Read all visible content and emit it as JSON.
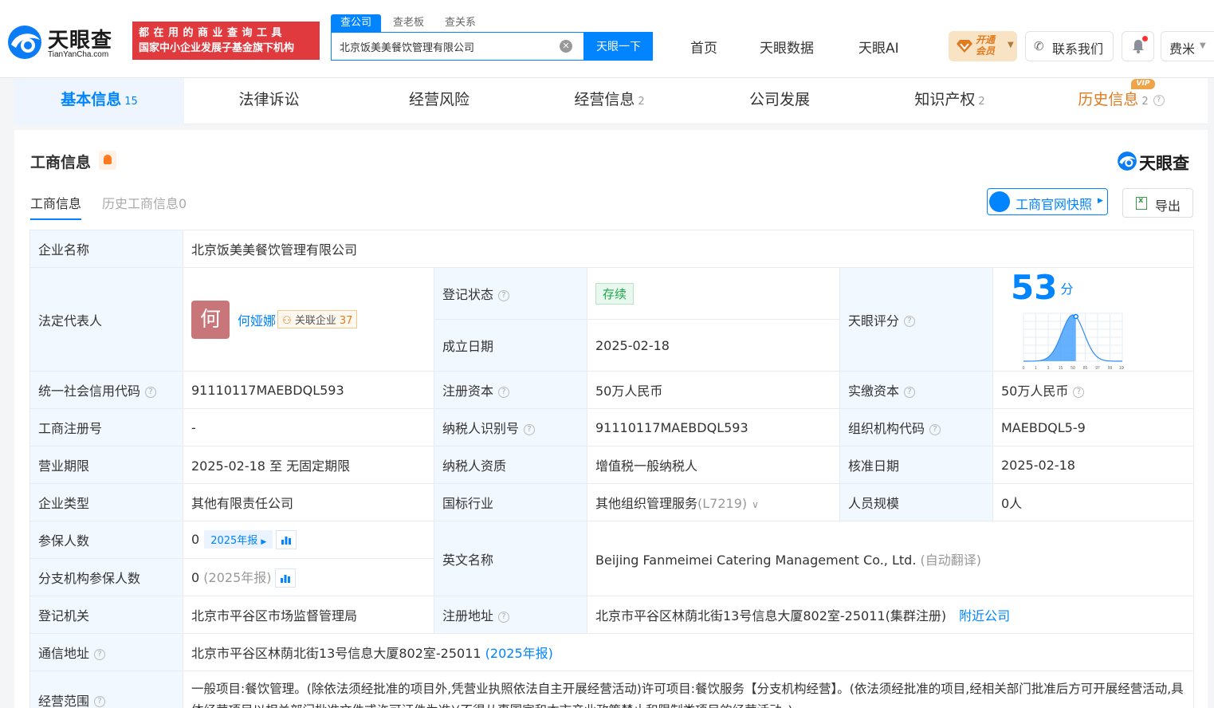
{
  "brand": {
    "logo_text": "天眼查",
    "logo_sub": "TianYanCha.com",
    "slogan_line1": "都在用的商业查询工具",
    "slogan_line2": "国家中小企业发展子基金旗下机构"
  },
  "search": {
    "tabs": [
      "查公司",
      "查老板",
      "查关系"
    ],
    "value": "北京饭美美餐饮管理有限公司",
    "button": "天眼一下"
  },
  "topnav": [
    "首页",
    "天眼数据",
    "天眼AI"
  ],
  "header_actions": {
    "vip_line1": "开通",
    "vip_line2": "会员",
    "contact": "联系我们",
    "user": "费米"
  },
  "main_tabs": [
    {
      "label": "基本信息",
      "count": "15"
    },
    {
      "label": "法律诉讼",
      "count": ""
    },
    {
      "label": "经营风险",
      "count": ""
    },
    {
      "label": "经营信息",
      "count": "2"
    },
    {
      "label": "公司发展",
      "count": ""
    },
    {
      "label": "知识产权",
      "count": "2"
    },
    {
      "label": "历史信息",
      "count": "2",
      "badge": "VIP"
    }
  ],
  "section": {
    "title": "工商信息",
    "brand": "天眼查",
    "subtabs": [
      "工商信息",
      "历史工商信息0"
    ],
    "snapshot_button": "工商官网快照",
    "export_button": "导出"
  },
  "info": {
    "company_name_label": "企业名称",
    "company_name": "北京饭美美餐饮管理有限公司",
    "legal_rep_label": "法定代表人",
    "legal_rep_avatar": "何",
    "legal_rep_name": "何娅娜",
    "related_label": "关联企业",
    "related_count": "37",
    "reg_status_label": "登记状态",
    "reg_status": "存续",
    "found_date_label": "成立日期",
    "found_date": "2025-02-18",
    "score_label": "天眼评分",
    "score": "53",
    "score_unit": "分",
    "score_chart_ticks": [
      "0",
      "1",
      "3",
      "15",
      "50",
      "85",
      "97",
      "99",
      "100"
    ],
    "credit_code_label": "统一社会信用代码",
    "credit_code": "91110117MAEBDQL593",
    "reg_capital_label": "注册资本",
    "reg_capital": "50万人民币",
    "paid_capital_label": "实缴资本",
    "paid_capital": "50万人民币",
    "reg_no_label": "工商注册号",
    "reg_no": "-",
    "taxpayer_id_label": "纳税人识别号",
    "taxpayer_id": "91110117MAEBDQL593",
    "org_code_label": "组织机构代码",
    "org_code": "MAEBDQL5-9",
    "term_label": "营业期限",
    "term": "2025-02-18 至 无固定期限",
    "taxpayer_qual_label": "纳税人资质",
    "taxpayer_qual": "增值税一般纳税人",
    "approve_date_label": "核准日期",
    "approve_date": "2025-02-18",
    "company_type_label": "企业类型",
    "company_type": "其他有限责任公司",
    "industry_label": "国标行业",
    "industry": "其他组织管理服务",
    "industry_code": "(L7219)",
    "staff_label": "人员规模",
    "staff": "0人",
    "insured_label": "参保人数",
    "insured": "0",
    "insured_report": "2025年报",
    "english_name_label": "英文名称",
    "english_name": "Beijing Fanmeimei Catering Management Co., Ltd.",
    "english_name_note": "(自动翻译)",
    "branch_insured_label": "分支机构参保人数",
    "branch_insured": "0",
    "branch_insured_note": "(2025年报)",
    "authority_label": "登记机关",
    "authority": "北京市平谷区市场监督管理局",
    "reg_address_label": "注册地址",
    "reg_address": "北京市平谷区林荫北街13号信息大厦802室-25011(集群注册)",
    "nearby": "附近公司",
    "mail_address_label": "通信地址",
    "mail_address": "北京市平谷区林荫北街13号信息大厦802室-25011",
    "mail_address_note": "(2025年报)",
    "scope_label": "经营范围",
    "scope": "一般项目:餐饮管理。(除依法须经批准的项目外,凭营业执照依法自主开展经营活动)许可项目:餐饮服务【分支机构经营】。(依法须经批准的项目,经相关部门批准后方可开展经营活动,具体经营项目以相关部门批准文件或许可证件为准)(不得从事国家和本市产业政策禁止和限制类项目的经营活动。)"
  },
  "colors": {
    "accent": "#0084ff",
    "slogan_bg": "#e0393e",
    "vip": "#e07a1f",
    "label_bg": "#f2f8ff",
    "status_green": "#1fa64a"
  }
}
